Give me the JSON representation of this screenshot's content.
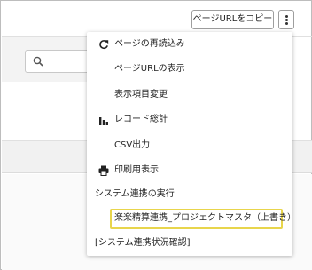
{
  "header": {
    "copy_url_button": "ページURLをコピー"
  },
  "search": {
    "placeholder": ""
  },
  "menu": {
    "items": [
      {
        "label": "ページの再読込み",
        "icon": "refresh-icon"
      },
      {
        "label": "ページURLの表示",
        "icon": ""
      },
      {
        "label": "表示項目変更",
        "icon": ""
      },
      {
        "label": "レコード総計",
        "icon": "bar-chart-icon"
      },
      {
        "label": "CSV出力",
        "icon": ""
      },
      {
        "label": "印刷用表示",
        "icon": "print-icon"
      }
    ],
    "section_title": "システム連携の実行",
    "integration_item": "楽楽精算連携_プロジェクトマスタ（上書き）",
    "status_link": "[システム連携状況確認]",
    "highlight_color": "#e8d54c"
  }
}
